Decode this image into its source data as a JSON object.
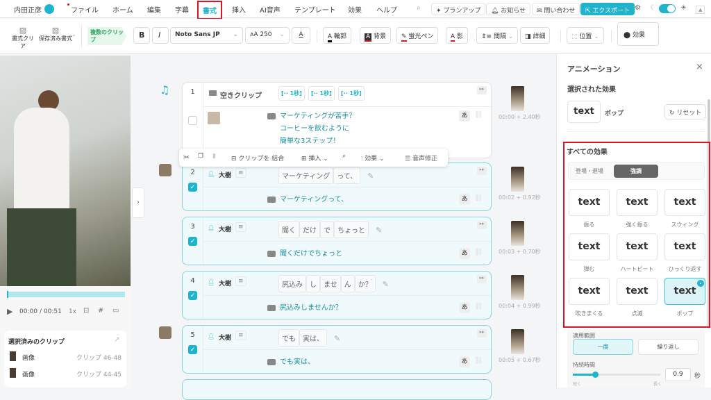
{
  "topnav": {
    "user": "内田正彦",
    "menus": [
      "ファイル",
      "ホーム",
      "編集",
      "字幕",
      "書式",
      "挿入",
      "AI音声",
      "テンプレート",
      "効果",
      "ヘルプ"
    ],
    "active_menu": "書式",
    "plan_up": "プランアップ",
    "notice": "お知らせ",
    "contact": "問い合わせ",
    "export": "エクスポート",
    "theme_toggle": "light"
  },
  "toolbar": {
    "clear_format": "書式クリア",
    "saved_format": "保存済み書式",
    "multi_clip": "複数のクリップ",
    "bold": "B",
    "italic": "I",
    "font": "Noto Sans JP",
    "font_size": "250",
    "outline": "輪郭",
    "background": "背景",
    "highlighter": "蛍光ペン",
    "shadow": "影",
    "spacing": "間隔",
    "detail": "詳細",
    "position": "位置",
    "effect": "効果"
  },
  "preview": {
    "time_current": "00:00",
    "time_total": "/ 00:51",
    "speed": "1x"
  },
  "selected_clips": {
    "title": "選択済みのクリップ",
    "items": [
      {
        "type": "画像",
        "range": "クリップ 46-48"
      },
      {
        "type": "画像",
        "range": "クリップ 44-45"
      }
    ]
  },
  "floating_toolbar": {
    "merge": "クリップを 結合",
    "insert": "挿入",
    "effect": "効果",
    "voice_fix": "音声修正"
  },
  "clips": [
    {
      "num": "1",
      "label": "空きクリップ",
      "pauses": [
        "[·· 1秒]",
        "[·· 1秒]",
        "[·· 1秒]"
      ],
      "subtitle": [
        "マーケティングが苦手？",
        "コーヒーを飲むように",
        "簡単な3ステップ！"
      ],
      "time": "00:00 + 2.40秒",
      "checked": false
    },
    {
      "num": "2",
      "speaker": "大樹",
      "words": [
        "マーケティング",
        "って、"
      ],
      "subtitle": [
        "マーケティングって、"
      ],
      "time": "00:02 + 0.92秒",
      "checked": true
    },
    {
      "num": "3",
      "speaker": "大樹",
      "words": [
        "聞く",
        "だけ",
        "で",
        "ちょっと"
      ],
      "subtitle": [
        "聞くだけでちょっと"
      ],
      "time": "00:03 + 0.70秒",
      "checked": true
    },
    {
      "num": "4",
      "speaker": "大樹",
      "words": [
        "尻込み",
        "し",
        "ませ",
        "ん",
        "か？"
      ],
      "subtitle": [
        "尻込みしませんか？"
      ],
      "time": "00:04 + 0.99秒",
      "checked": true
    },
    {
      "num": "5",
      "speaker": "大樹",
      "words": [
        "でも",
        "実は、"
      ],
      "subtitle": [
        "でも実は、"
      ],
      "time": "00:05 + 0.67秒",
      "checked": true
    }
  ],
  "kana_button": "あ",
  "animation": {
    "title": "アニメーション",
    "selected_heading": "選択された効果",
    "preview_text": "text",
    "selected_name": "ポップ",
    "reset": "リセット",
    "all_heading": "すべての効果",
    "tabs": [
      "登場・退場",
      "強調"
    ],
    "active_tab": "強調",
    "effects": [
      {
        "name": "振る"
      },
      {
        "name": "強く振る"
      },
      {
        "name": "スウィング"
      },
      {
        "name": "弾む"
      },
      {
        "name": "ハートビート"
      },
      {
        "name": "ひっくり返す"
      },
      {
        "name": "吹きまくる"
      },
      {
        "name": "点滅"
      },
      {
        "name": "ポップ",
        "selected": true
      }
    ],
    "scope_label": "適用範囲",
    "scope_options": [
      "一度",
      "繰り返し"
    ],
    "scope_selected": "一度",
    "duration_label": "持続時間",
    "duration_value": "0.9",
    "duration_unit": "秒",
    "slider_min_label": "短く",
    "slider_max_label": "長く",
    "duration_fraction": 0.25
  },
  "colors": {
    "accent": "#1fb4cc",
    "highlight": "#e0141e"
  }
}
